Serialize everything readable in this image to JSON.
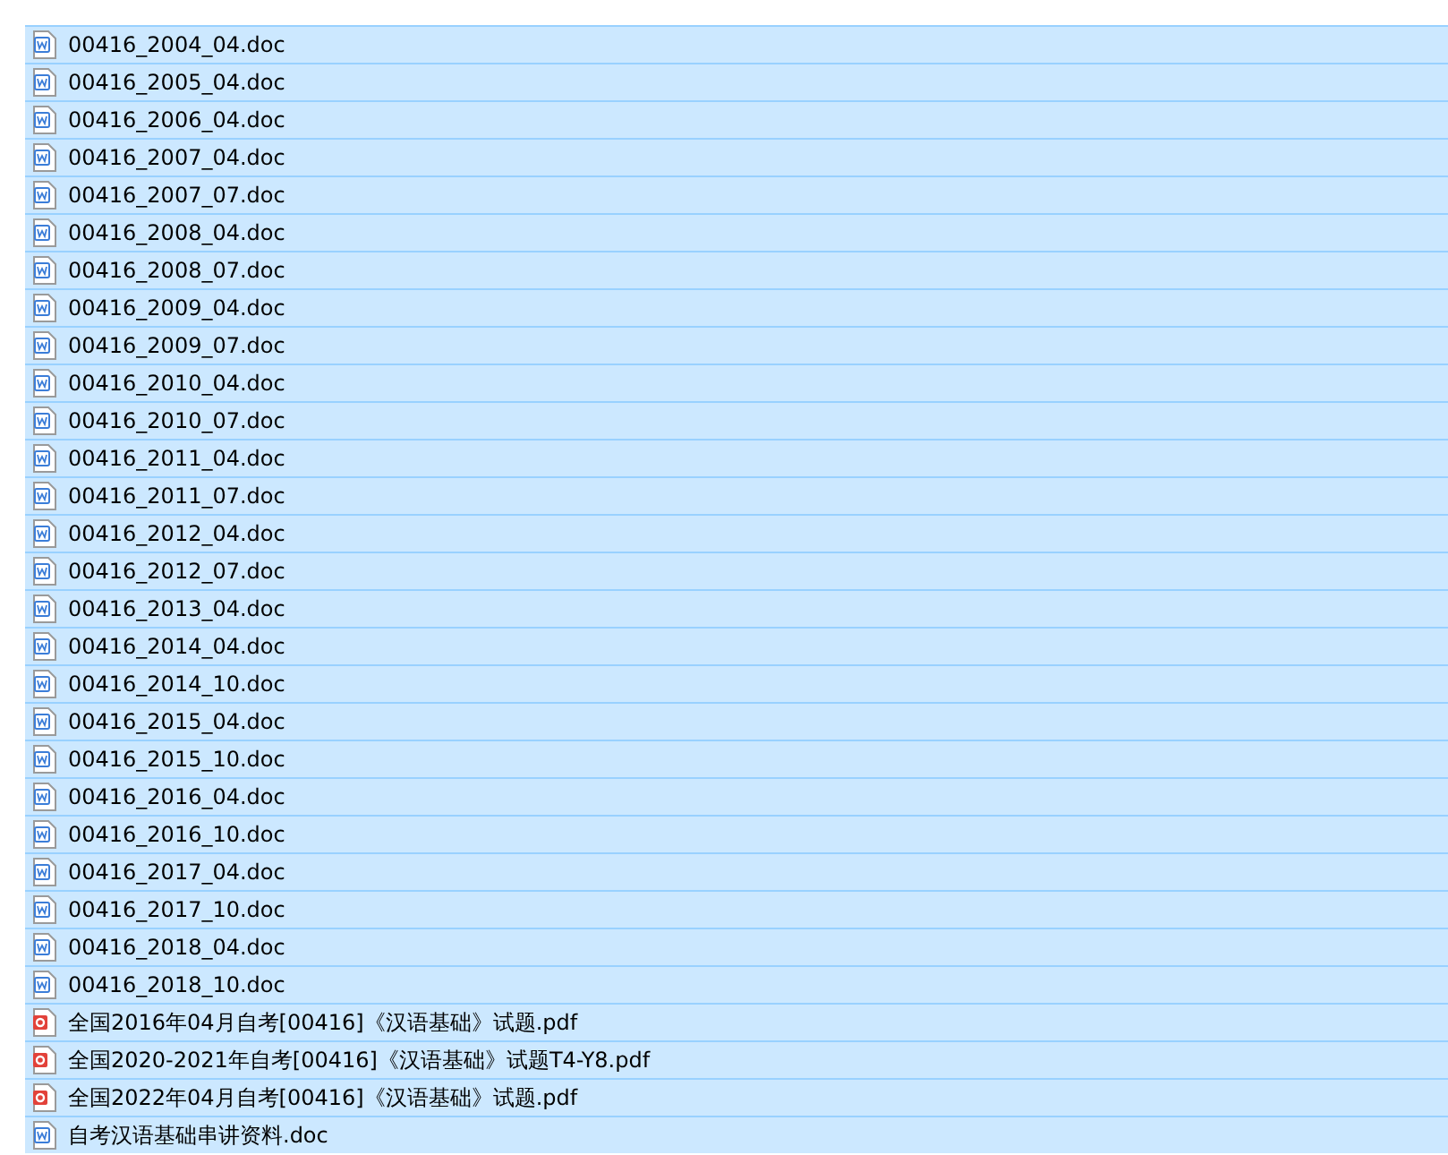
{
  "files": [
    {
      "name": "00416_2004_04.doc",
      "kind": "word",
      "selected": true
    },
    {
      "name": "00416_2005_04.doc",
      "kind": "word",
      "selected": true
    },
    {
      "name": "00416_2006_04.doc",
      "kind": "word",
      "selected": true
    },
    {
      "name": "00416_2007_04.doc",
      "kind": "word",
      "selected": true
    },
    {
      "name": "00416_2007_07.doc",
      "kind": "word",
      "selected": true
    },
    {
      "name": "00416_2008_04.doc",
      "kind": "word",
      "selected": true
    },
    {
      "name": "00416_2008_07.doc",
      "kind": "word",
      "selected": true
    },
    {
      "name": "00416_2009_04.doc",
      "kind": "word",
      "selected": true
    },
    {
      "name": "00416_2009_07.doc",
      "kind": "word",
      "selected": true
    },
    {
      "name": "00416_2010_04.doc",
      "kind": "word",
      "selected": true
    },
    {
      "name": "00416_2010_07.doc",
      "kind": "word",
      "selected": true
    },
    {
      "name": "00416_2011_04.doc",
      "kind": "word",
      "selected": true
    },
    {
      "name": "00416_2011_07.doc",
      "kind": "word",
      "selected": true
    },
    {
      "name": "00416_2012_04.doc",
      "kind": "word",
      "selected": true
    },
    {
      "name": "00416_2012_07.doc",
      "kind": "word",
      "selected": true
    },
    {
      "name": "00416_2013_04.doc",
      "kind": "word",
      "selected": true
    },
    {
      "name": "00416_2014_04.doc",
      "kind": "word",
      "selected": true
    },
    {
      "name": "00416_2014_10.doc",
      "kind": "word",
      "selected": true
    },
    {
      "name": "00416_2015_04.doc",
      "kind": "word",
      "selected": true
    },
    {
      "name": "00416_2015_10.doc",
      "kind": "word",
      "selected": true
    },
    {
      "name": "00416_2016_04.doc",
      "kind": "word",
      "selected": true
    },
    {
      "name": "00416_2016_10.doc",
      "kind": "word",
      "selected": true
    },
    {
      "name": "00416_2017_04.doc",
      "kind": "word",
      "selected": true
    },
    {
      "name": "00416_2017_10.doc",
      "kind": "word",
      "selected": true
    },
    {
      "name": "00416_2018_04.doc",
      "kind": "word",
      "selected": true
    },
    {
      "name": "00416_2018_10.doc",
      "kind": "word",
      "selected": true
    },
    {
      "name": "全国2016年04月自考[00416]《汉语基础》试题.pdf",
      "kind": "pdf",
      "selected": true
    },
    {
      "name": "全国2020-2021年自考[00416]《汉语基础》试题T4-Y8.pdf",
      "kind": "pdf",
      "selected": true
    },
    {
      "name": "全国2022年04月自考[00416]《汉语基础》试题.pdf",
      "kind": "pdf",
      "selected": true
    },
    {
      "name": "自考汉语基础串讲资料.doc",
      "kind": "word",
      "selected": true
    }
  ]
}
